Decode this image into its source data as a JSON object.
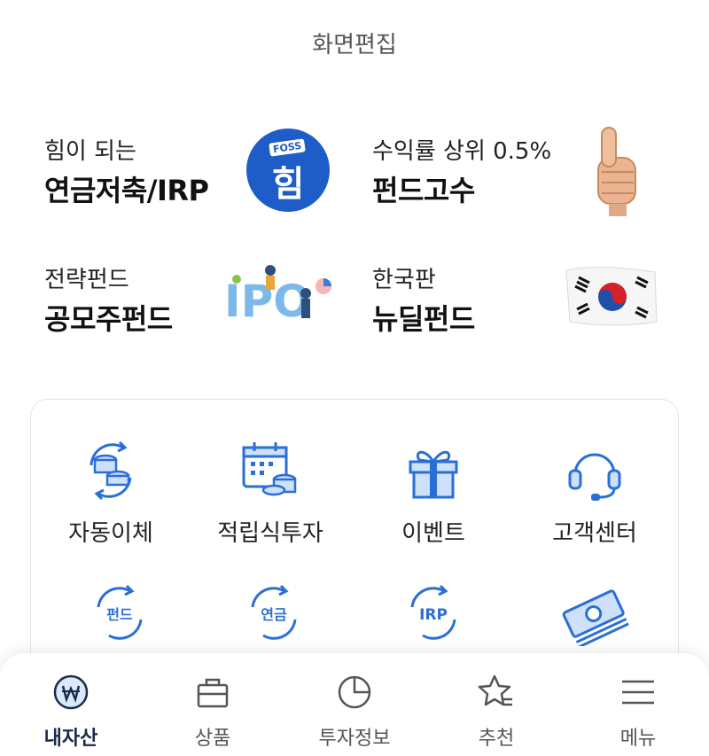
{
  "header": {
    "title": "화면편집"
  },
  "promos": [
    {
      "sub": "힘이 되는",
      "main": "연금저축/IRP",
      "badge_top": "FOSS",
      "badge_main": "힘"
    },
    {
      "sub": "수익률 상위 0.5%",
      "main": "펀드고수",
      "art": "thumbs-up-icon"
    },
    {
      "sub": "전략펀드",
      "main": "공모주펀드",
      "art_text": "IPO"
    },
    {
      "sub": "한국판",
      "main": "뉴딜펀드",
      "art": "korean-flag-icon"
    }
  ],
  "quick_menu": {
    "row1": [
      {
        "label": "자동이체",
        "icon": "coin-exchange-icon"
      },
      {
        "label": "적립식투자",
        "icon": "calendar-coins-icon"
      },
      {
        "label": "이벤트",
        "icon": "gift-icon"
      },
      {
        "label": "고객센터",
        "icon": "headset-icon"
      }
    ],
    "row2": [
      {
        "badge": "펀드",
        "icon": "fund-exchange-icon"
      },
      {
        "badge": "연금",
        "icon": "pension-exchange-icon"
      },
      {
        "badge": "IRP",
        "icon": "irp-exchange-icon"
      },
      {
        "icon": "money-stack-icon"
      }
    ]
  },
  "tabbar": {
    "active": "내자산",
    "items": [
      {
        "label": "내자산",
        "icon": "won-icon"
      },
      {
        "label": "상품",
        "icon": "bag-icon"
      },
      {
        "label": "투자정보",
        "icon": "pie-chart-icon"
      },
      {
        "label": "추천",
        "icon": "star-list-icon"
      },
      {
        "label": "메뉴",
        "icon": "hamburger-icon"
      }
    ]
  },
  "colors": {
    "accent": "#2a6fd6",
    "active_tab": "#1c2b4a",
    "badge": "#1e5dc8"
  }
}
